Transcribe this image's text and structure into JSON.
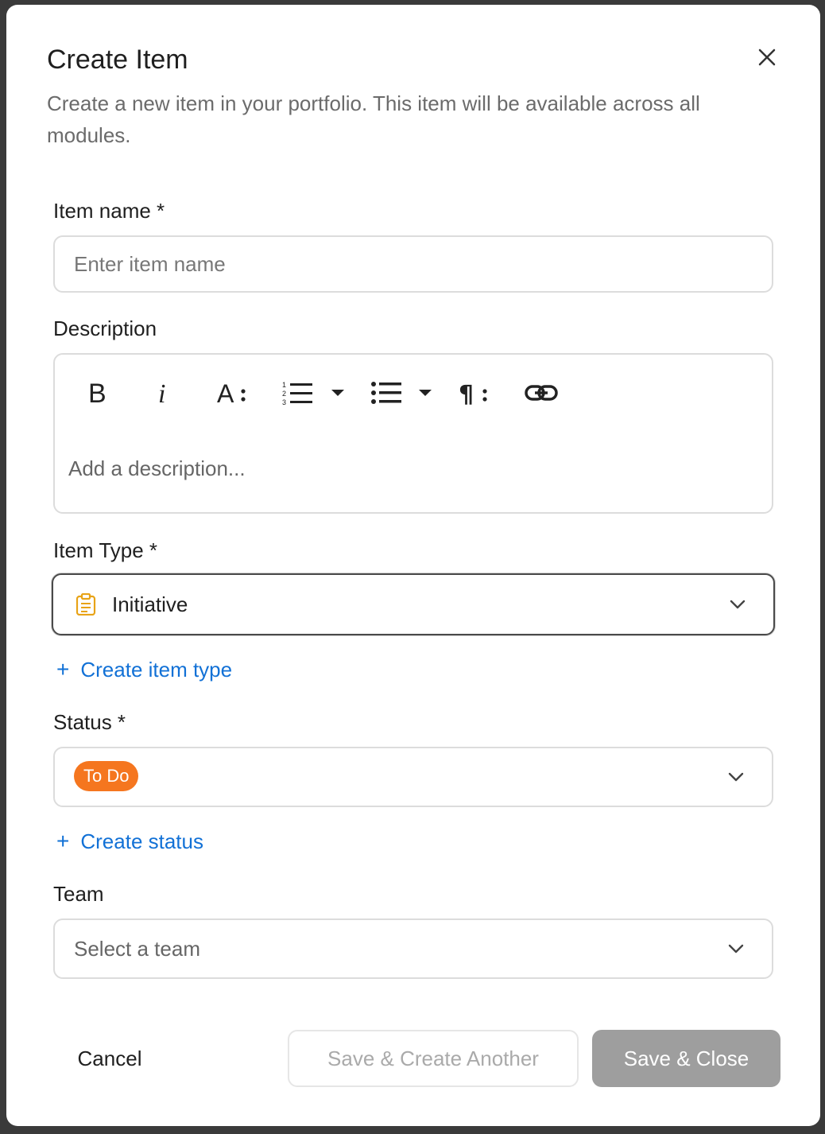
{
  "dialog": {
    "title": "Create Item",
    "subtitle": "Create a new item in your portfolio. This item will be available across all modules."
  },
  "form": {
    "item_name": {
      "label": "Item name *",
      "placeholder": "Enter item name",
      "value": ""
    },
    "description": {
      "label": "Description",
      "placeholder": "Add a description...",
      "toolbar": [
        "bold-icon",
        "italic-icon",
        "font-size-icon",
        "numbered-list-icon",
        "bulleted-list-icon",
        "paragraph-icon",
        "link-icon"
      ]
    },
    "item_type": {
      "label": "Item Type *",
      "value": "Initiative",
      "icon": "clipboard-icon",
      "icon_color": "#e8a317"
    },
    "create_item_type": {
      "plus": "+",
      "label": "Create item type"
    },
    "status": {
      "label": "Status *",
      "value": "To Do",
      "badge_color": "#f5761f"
    },
    "create_status": {
      "plus": "+",
      "label": "Create status"
    },
    "team": {
      "label": "Team",
      "placeholder": "Select a team"
    }
  },
  "footer": {
    "cancel": "Cancel",
    "save_create_another": "Save & Create Another",
    "save_close": "Save & Close"
  },
  "colors": {
    "link": "#1271d6",
    "disabled_button": "#9e9e9e"
  }
}
